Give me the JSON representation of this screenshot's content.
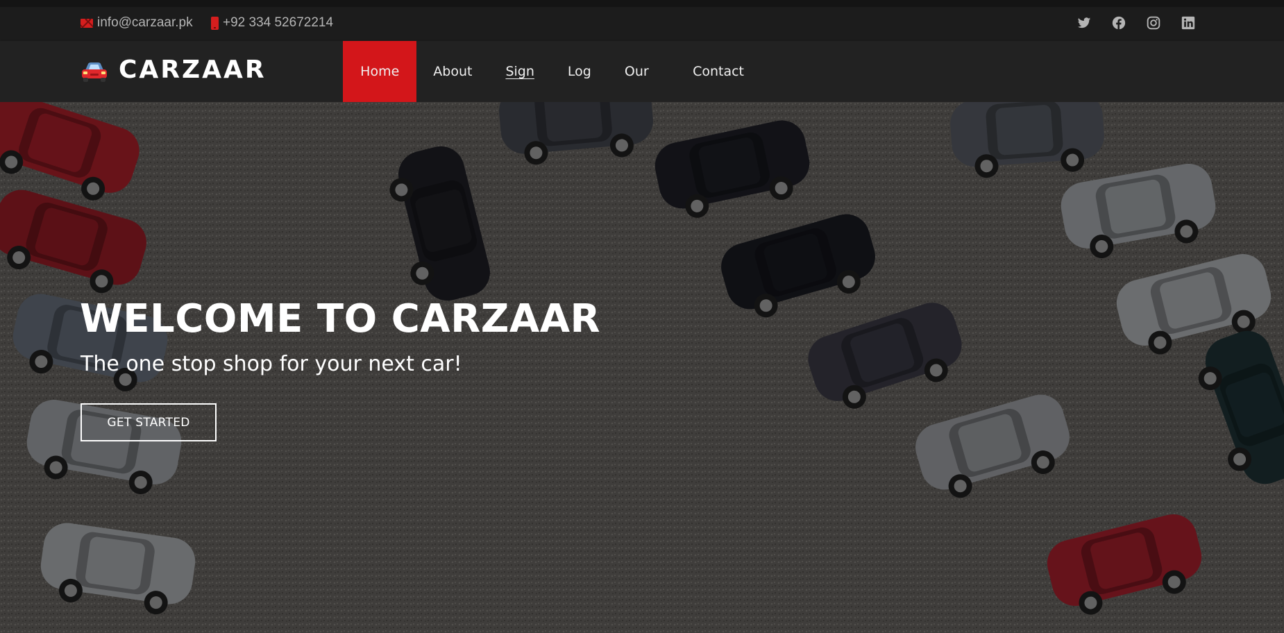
{
  "topbar": {
    "email": "info@carzaar.pk",
    "phone": "+92 334 52672214",
    "socials": [
      "twitter-icon",
      "facebook-icon",
      "instagram-icon",
      "linkedin-icon"
    ]
  },
  "brand": {
    "name": "CARZAAR",
    "logo_icon": "car-icon"
  },
  "nav": {
    "items": [
      {
        "label": "Home",
        "active": true
      },
      {
        "label": "About"
      },
      {
        "label": "Sign Up"
      },
      {
        "label": "Log In"
      },
      {
        "label": "Our Team"
      },
      {
        "label": "Contact Us"
      }
    ]
  },
  "hero": {
    "title": "WELCOME TO CARZAAR",
    "subtitle": "The one stop shop for your next car!",
    "cta_label": "GET STARTED"
  },
  "colors": {
    "accent": "#d3161a",
    "topbar": "#1c1c1c",
    "navbar": "#222222"
  }
}
